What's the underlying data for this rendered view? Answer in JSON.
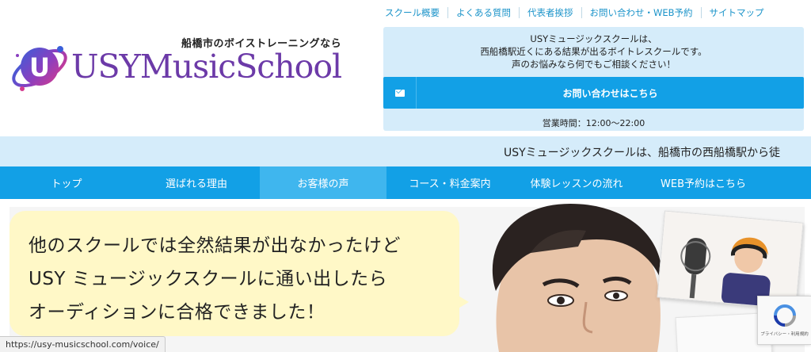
{
  "top_links": [
    "スクール概要",
    "よくある質問",
    "代表者挨拶",
    "お問い合わせ・WEB予約",
    "サイトマップ"
  ],
  "logo": {
    "tagline": "船橋市のボイストレーニングなら",
    "text": "USYMusicSchool",
    "mark_letter": "U"
  },
  "info": {
    "line1": "USYミュージックスクールは、",
    "line2": "西船橋駅近くにある結果が出るボイトレスクールです。",
    "line3": "声のお悩みなら何でもご相談ください！",
    "contact_button": "お問い合わせはこちら",
    "hours": "営業時間：12:00〜22:00"
  },
  "marquee": "USYミュージックスクールは、船橋市の西船橋駅から徒",
  "nav": [
    {
      "label": "トップ"
    },
    {
      "label": "選ばれる理由"
    },
    {
      "label": "お客様の声"
    },
    {
      "label": "コース・料金案内"
    },
    {
      "label": "体験レッスンの流れ"
    },
    {
      "label": "WEB予約はこちら"
    }
  ],
  "hero": {
    "line1": "他のスクールでは全然結果が出なかったけど",
    "line2": "USY ミュージックスクールに通い出したら",
    "line3": "オーディションに合格できました！"
  },
  "recaptcha": {
    "sub": "プライバシー・利用規約"
  },
  "status_url": "https://usy-musicschool.com/voice/",
  "colors": {
    "accent": "#12a0e6",
    "light": "#d5ecfa",
    "bubble": "#fff8c7",
    "brand": "#6c3aa8"
  }
}
